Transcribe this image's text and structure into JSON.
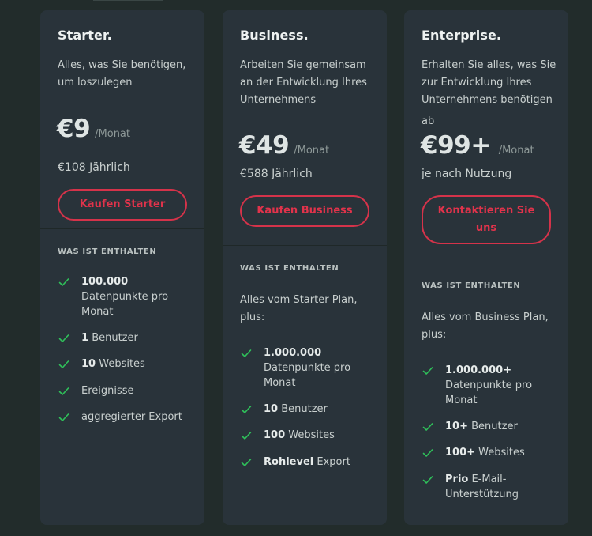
{
  "plans": {
    "starter": {
      "title": "Starter.",
      "description": "Alles, was Sie benötigen, um loszulegen",
      "price": "€9",
      "per": "/Monat",
      "yearly": "€108 Jährlich",
      "cta": "Kaufen Starter",
      "section_label": "WAS IST ENTHALTEN",
      "features": [
        {
          "bold": "100.000",
          "text": "Datenpunkte pro Monat"
        },
        {
          "bold": "1",
          "text": "Benutzer"
        },
        {
          "bold": "10",
          "text": "Websites"
        },
        {
          "bold": "",
          "text": "Ereignisse"
        },
        {
          "bold": "",
          "text": "aggregierter Export"
        }
      ]
    },
    "business": {
      "title": "Business.",
      "description": "Arbeiten Sie gemeinsam an der Entwicklung Ihres Unternehmens",
      "price": "€49",
      "per": "/Monat",
      "yearly": "€588 Jährlich",
      "cta": "Kaufen Business",
      "section_label": "WAS IST ENTHALTEN",
      "intro": "Alles vom Starter Plan, plus:",
      "features": [
        {
          "bold": "1.000.000",
          "text": "Datenpunkte pro Monat"
        },
        {
          "bold": "10",
          "text": "Benutzer"
        },
        {
          "bold": "100",
          "text": "Websites"
        },
        {
          "bold": "Rohlevel",
          "text": "Export"
        }
      ]
    },
    "enterprise": {
      "title": "Enterprise.",
      "description": "Erhalten Sie alles, was Sie zur Entwicklung Ihres Unternehmens benötigen",
      "prefix": "ab",
      "price": "€99+",
      "per": "/Monat",
      "usage_note": "je nach Nutzung",
      "cta": "Kontaktieren Sie uns",
      "section_label": "WAS IST ENTHALTEN",
      "intro": "Alles vom Business Plan, plus:",
      "features": [
        {
          "bold": "1.000.000+",
          "text": "Datenpunkte pro Monat"
        },
        {
          "bold": "10+",
          "text": "Benutzer"
        },
        {
          "bold": "100+",
          "text": "Websites"
        },
        {
          "bold": "Prio",
          "text": "E-Mail-Unterstützung"
        }
      ]
    }
  },
  "colors": {
    "background": "#222c2b",
    "card": "#29333a",
    "accent": "#e0334b",
    "check": "#2fc15a"
  }
}
